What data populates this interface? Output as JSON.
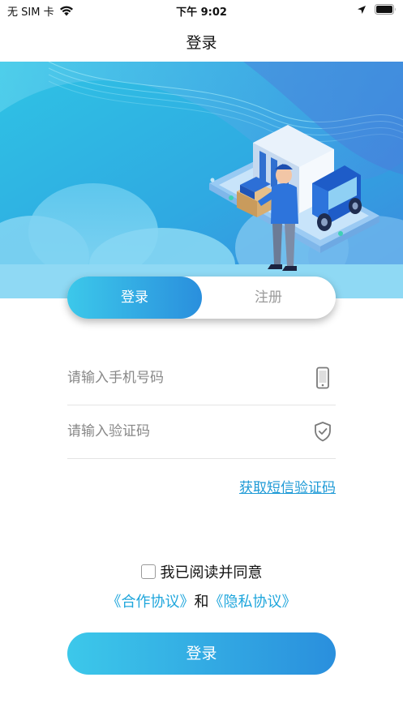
{
  "status_bar": {
    "carrier": "无 SIM 卡",
    "time": "下午 9:02",
    "icons": [
      "wifi-icon",
      "location-icon",
      "battery-icon"
    ]
  },
  "nav": {
    "title": "登录"
  },
  "banner": {
    "illustration": "delivery-truck-courier"
  },
  "tabs": [
    {
      "label": "登录",
      "active": true
    },
    {
      "label": "注册",
      "active": false
    }
  ],
  "form": {
    "phone": {
      "placeholder": "请输入手机号码",
      "value": "",
      "icon": "phone-icon"
    },
    "code": {
      "placeholder": "请输入验证码",
      "value": "",
      "icon": "shield-check-icon"
    },
    "sms_link": "获取短信验证码"
  },
  "agreement": {
    "checked": false,
    "text": "我已阅读并同意",
    "link1": "《合作协议》",
    "conjunction": "和",
    "link2": "《隐私协议》"
  },
  "submit": {
    "label": "登录"
  },
  "colors": {
    "accent_start": "#3cc8ea",
    "accent_end": "#2a8fdd",
    "link": "#1e9ad6"
  }
}
